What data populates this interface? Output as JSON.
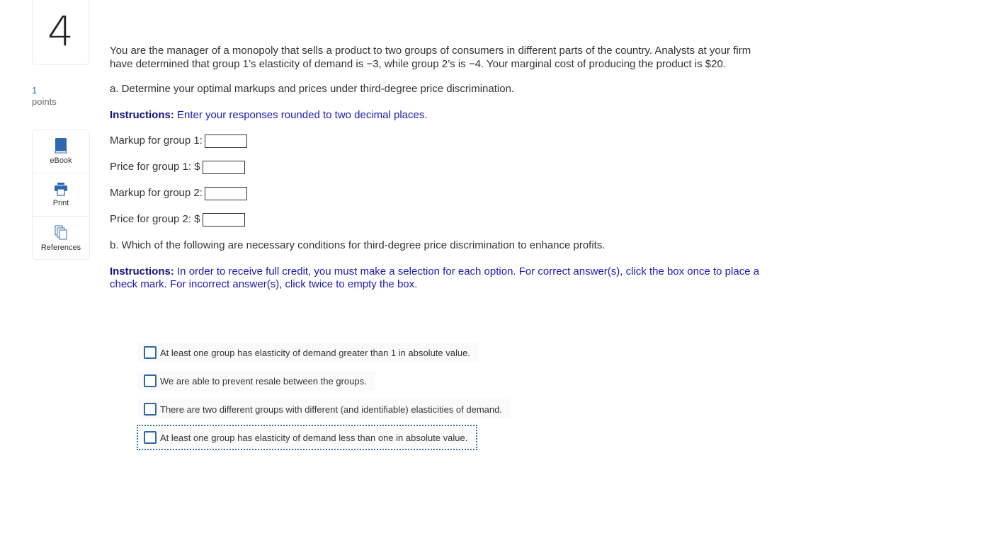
{
  "question": {
    "number": "4",
    "points_value": "1",
    "points_label": "points"
  },
  "tools": [
    {
      "label": "eBook",
      "icon": "book-icon"
    },
    {
      "label": "Print",
      "icon": "printer-icon"
    },
    {
      "label": "References",
      "icon": "documents-icon"
    }
  ],
  "body": {
    "intro": "You are the manager of a monopoly that sells a product to two groups of consumers in different parts of the country. Analysts at your firm have determined that group 1’s elasticity of demand is −3, while group 2’s is −4. Your marginal cost of producing the product is $20.",
    "part_a": "a. Determine your optimal markups and prices under third-degree price discrimination.",
    "instr_a_label": "Instructions:",
    "instr_a_text": " Enter your responses rounded to two decimal places.",
    "fields": [
      {
        "label": "Markup for group 1:",
        "value": ""
      },
      {
        "label": "Price for group 1: $",
        "value": ""
      },
      {
        "label": "Markup for group 2:",
        "value": ""
      },
      {
        "label": "Price for group 2: $",
        "value": ""
      }
    ],
    "part_b": "b. Which of the following are necessary conditions for third-degree price discrimination to enhance profits.",
    "instr_b_label": "Instructions:",
    "instr_b_text": " In order to receive full credit, you must make a selection for each option. For correct answer(s), click the box once to place a check mark. For incorrect answer(s), click twice to empty the box.",
    "options": [
      {
        "label": "At least one group has elasticity of demand greater than 1 in absolute value.",
        "checked": false
      },
      {
        "label": "We are able to prevent resale between the groups.",
        "checked": false
      },
      {
        "label": "There are two different groups with different (and identifiable) elasticities of demand.",
        "checked": false
      },
      {
        "label": "At least one group has elasticity of demand less than one in absolute value.",
        "checked": false,
        "focused": true
      }
    ]
  }
}
